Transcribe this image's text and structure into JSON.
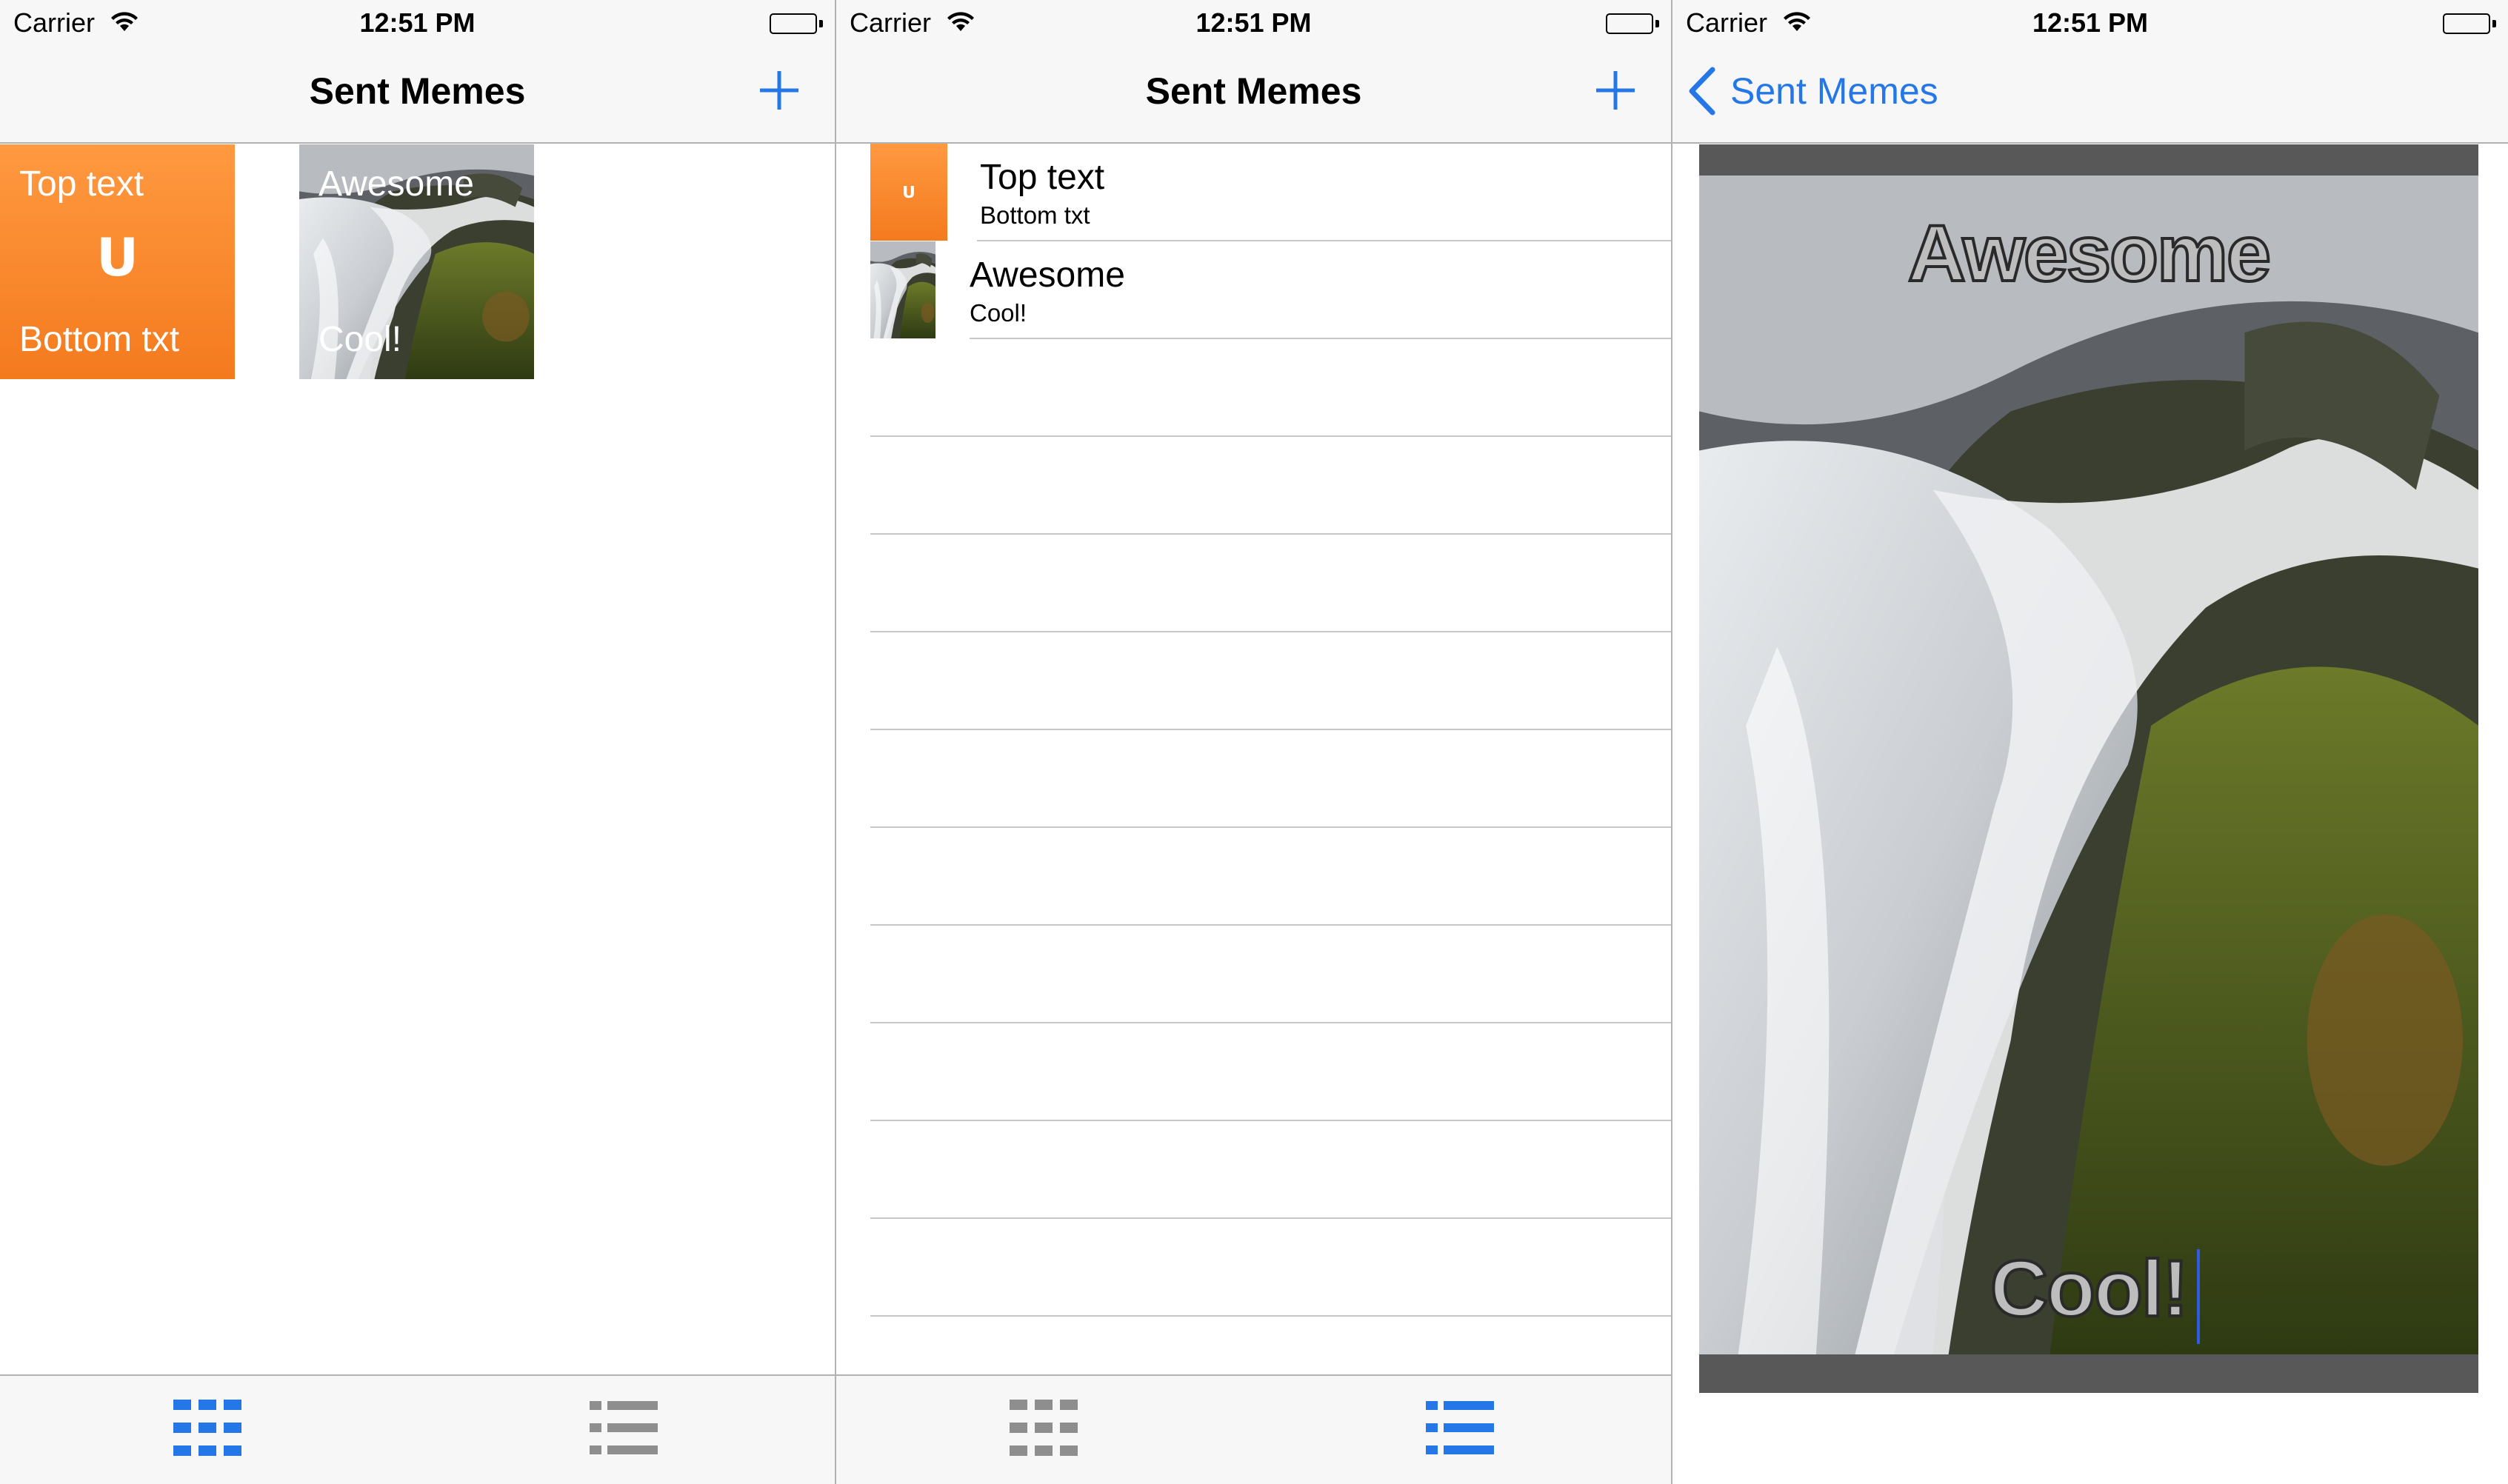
{
  "colors": {
    "accent": "#2577e7",
    "orange": "#f47a1e",
    "tab_inactive": "#8e8e8e"
  },
  "status": {
    "carrier": "Carrier",
    "time": "12:51 PM"
  },
  "grid_screen": {
    "title": "Sent Memes",
    "tiles": [
      {
        "top": "Top text",
        "logo": "ᑌ",
        "bottom": "Bottom txt"
      },
      {
        "top": "Awesome",
        "bottom": "Cool!"
      }
    ],
    "tabs": [
      {
        "icon": "grid-icon",
        "active": true
      },
      {
        "icon": "list-icon",
        "active": false
      }
    ]
  },
  "list_screen": {
    "title": "Sent Memes",
    "rows": [
      {
        "title": "Top text",
        "subtitle": "Bottom txt",
        "thumb_logo": "ᑌ"
      },
      {
        "title": "Awesome",
        "subtitle": "Cool!"
      }
    ],
    "tabs": [
      {
        "icon": "grid-icon",
        "active": false
      },
      {
        "icon": "list-icon",
        "active": true
      }
    ]
  },
  "detail_screen": {
    "back_label": "Sent Memes",
    "meme_top": "Awesome",
    "meme_bottom": "Cool!"
  }
}
